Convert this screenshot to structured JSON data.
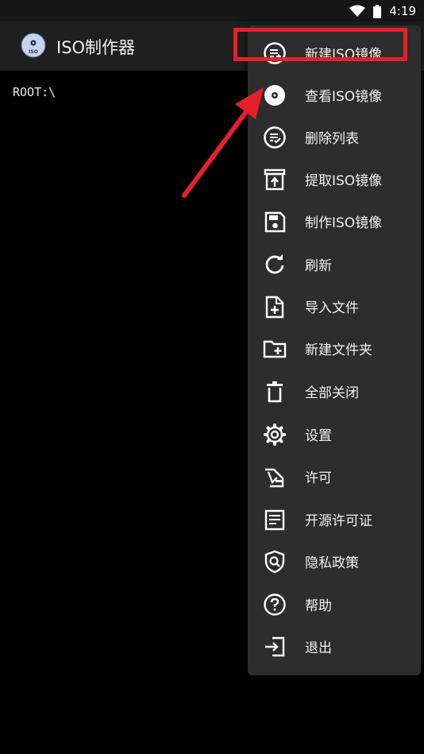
{
  "status_bar": {
    "time": "4:19",
    "icons": [
      "wifi-icon",
      "battery-icon"
    ]
  },
  "app_bar": {
    "title": "ISO制作器",
    "logo_text": "ISO"
  },
  "main": {
    "root_path": "ROOT:\\"
  },
  "menu": {
    "items": [
      {
        "label": "新建ISO镜像",
        "icon": "new-list-icon"
      },
      {
        "label": "查看ISO镜像",
        "icon": "disc-icon"
      },
      {
        "label": "删除列表",
        "icon": "delete-list-icon"
      },
      {
        "label": "提取ISO镜像",
        "icon": "extract-icon"
      },
      {
        "label": "制作ISO镜像",
        "icon": "save-icon"
      },
      {
        "label": "刷新",
        "icon": "refresh-icon"
      },
      {
        "label": "导入文件",
        "icon": "import-file-icon"
      },
      {
        "label": "新建文件夹",
        "icon": "new-folder-icon"
      },
      {
        "label": "全部关闭",
        "icon": "trash-icon"
      },
      {
        "label": "设置",
        "icon": "gear-icon"
      },
      {
        "label": "许可",
        "icon": "license-icon"
      },
      {
        "label": "开源许可证",
        "icon": "document-icon"
      },
      {
        "label": "隐私政策",
        "icon": "shield-icon"
      },
      {
        "label": "帮助",
        "icon": "help-icon"
      },
      {
        "label": "退出",
        "icon": "exit-icon"
      }
    ]
  },
  "colors": {
    "annotation": "#e5202a",
    "menu_bg": "#2d2d2d",
    "app_bar_bg": "#1f1f1f"
  }
}
